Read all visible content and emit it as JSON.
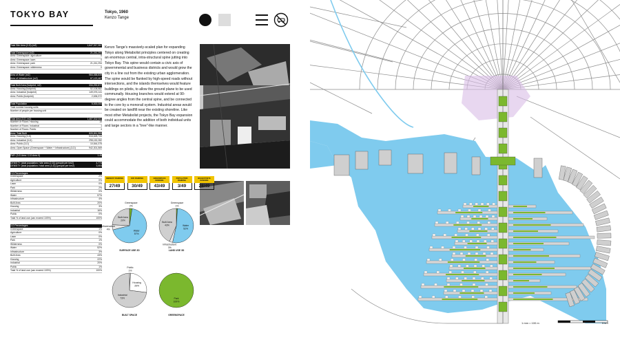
{
  "header": {
    "title": "TOKYO BAY",
    "project_line": "Tokyo, 1960",
    "architect": "Kenzo Tange"
  },
  "stats": [
    {
      "label": "Total Site Area (2-D) (m2)",
      "value": "1,647,317,357",
      "hl": true
    },
    {
      "gap": true
    },
    {
      "label": "Total Greenspace (m2)",
      "value": "21,241,294",
      "hl": true
    },
    {
      "label": "Area: Greenspace: agriculture",
      "value": "0"
    },
    {
      "label": "Area: Greenspace: lawn",
      "value": "0"
    },
    {
      "label": "Area: Greenspace: park",
      "value": "21,241,294"
    },
    {
      "label": "Area: Greenspace: wilderness",
      "value": "0"
    },
    {
      "gap": true
    },
    {
      "label": "Area of Water (m2)",
      "value": "964,458,839",
      "hl": true
    },
    {
      "label": "Area of Infrastructure (m2)",
      "value": "67,122,467",
      "hl": true
    },
    {
      "gap": true
    },
    {
      "label": "Total Built Area (footprint, m2)",
      "value": "334,292,877",
      "hl": true
    },
    {
      "label": "Area: Housing (footprint)",
      "value": "52,108,582"
    },
    {
      "label": "Area: Industrial (footprint)",
      "value": "149,076,141"
    },
    {
      "label": "Area: Public (footprint)",
      "value": "2,636,372"
    },
    {
      "gap": true
    },
    {
      "label": "Total Population",
      "value": "5,000,000",
      "hl": true
    },
    {
      "label": "Total number housing units",
      "value": ""
    },
    {
      "label": "Number of people per housing unit",
      "value": ""
    },
    {
      "gap": true
    },
    {
      "label": "Total Area (3-D, m2)",
      "value": "1,487,532,511",
      "hl": true
    },
    {
      "label": "Number of Floors: Housing",
      "value": "15"
    },
    {
      "label": "Number of Floors: Industrial",
      "value": "1"
    },
    {
      "label": "Number of Floors: Public",
      "value": "4"
    },
    {
      "label": "Area: Total Built",
      "value": "820,811,959",
      "hl": true
    },
    {
      "label": "Area: Housing (3-D)",
      "value": "516,628,733"
    },
    {
      "label": "Area: Industrial (3-D)",
      "value": "298,152,282"
    },
    {
      "label": "Area: Public (3-D)",
      "value": "10,544,375"
    },
    {
      "label": "Area: Open Space (Greenspace + Water + Infrastructure) (3-D)",
      "value": "942,301,569"
    },
    {
      "gap": true
    },
    {
      "label": "FAR: (3-D Area / 2-D Area 0)",
      "value": "1.49",
      "hl": true
    },
    {
      "gap": true
    },
    {
      "label": "DENSITY (total population / site area (2-D)) (people per km2)",
      "value": "4,774",
      "hl": true
    },
    {
      "label": "DENSITY (total population / total area (3-D)) (people per km2)",
      "value": "3,404",
      "hl": true
    },
    {
      "gap": true
    },
    {
      "label": "2-D Percentages",
      "value": "",
      "hl": true
    },
    {
      "label": "Greenspace",
      "value": "2%"
    },
    {
      "label": "Agriculture",
      "value": "0%"
    },
    {
      "label": "Lawn",
      "value": "0%"
    },
    {
      "label": "Park",
      "value": "2%"
    },
    {
      "label": "Wilderness",
      "value": "0%"
    },
    {
      "label": "Water",
      "value": "57%"
    },
    {
      "label": "Infrastructure",
      "value": "4%"
    },
    {
      "label": "Built Area",
      "value": "20%"
    },
    {
      "label": "Housing",
      "value": "3%"
    },
    {
      "label": "Industrial",
      "value": "16%"
    },
    {
      "label": "Public",
      "value": "0%"
    },
    {
      "label": "Total % of land use (can exceed 100%)",
      "value": "100%"
    },
    {
      "gap": true
    },
    {
      "label": "3-D Percentages",
      "value": "",
      "hl": true
    },
    {
      "label": "Greenspace",
      "value": "1%"
    },
    {
      "label": "Agriculture",
      "value": "0%"
    },
    {
      "label": "Lawn",
      "value": "0%"
    },
    {
      "label": "Park",
      "value": "1%"
    },
    {
      "label": "Wilderness",
      "value": "0%"
    },
    {
      "label": "Water",
      "value": "52%"
    },
    {
      "label": "Infrastructure",
      "value": "3%"
    },
    {
      "label": "Built Area",
      "value": "43%"
    },
    {
      "label": "Housing",
      "value": "22%"
    },
    {
      "label": "Industrial",
      "value": "20%"
    },
    {
      "label": "Public",
      "value": "1%"
    },
    {
      "label": "Total % of land use (can exceed 100%)",
      "value": "100%"
    }
  ],
  "description": "Kenzo Tange's massively-scaled plan for expanding Tokyo along Metabolist principles centered on creating an enormous central, intra-structural spine jutting into Tokyo Bay. This spine would contain a civic axis of governmental and business districts and would grow the city in a line out from the existing urban agglomeration. The spine would be flanked by high-speed roads without intersections, and the islands themselves would feature buildings on pilotis, to allow the ground plane to be used communally. Housing branches would extend at 90-degree angles from the central spine, and be connected to the core by a monorail system. Industrial areas would be created on landfill near the existing shoreline. Like most other Metabolist projects, the Tokyo Bay expansion could accommodate the addition of both individual units and large sectors in a \"tree\"-like manner.",
  "rankings": [
    {
      "label": "DENSEST RANKING",
      "value": "27/49"
    },
    {
      "label": "FAR RANKING",
      "value": "30/49"
    },
    {
      "label": "GREENSPACE RANKING",
      "value": "43/49"
    },
    {
      "label": "POPULATION RANKING",
      "value": "3/49"
    },
    {
      "label": "BIGGEST/SITE RANKING",
      "value": "28/49"
    }
  ],
  "colors": {
    "water": "#7fcbee",
    "green": "#7bb82e",
    "built": "#cfcfcf",
    "infra": "#e8e8e8",
    "highlight": "#f1c400",
    "land": "#ffffff",
    "road": "#8a8a8a",
    "lilac": "#d9bce6"
  },
  "chart_data": [
    {
      "type": "pie",
      "title": "SURFACE USE 2D",
      "slices": [
        {
          "label": "Greenspace",
          "value": 2,
          "pct": "2%",
          "color": "#7bb82e"
        },
        {
          "label": "Water",
          "value": 57,
          "pct": "57%",
          "color": "#7fcbee"
        },
        {
          "label": "Infrastructure",
          "value": 4,
          "pct": "4%",
          "color": "#e8e8e8"
        },
        {
          "label": "Built Area",
          "value": 20,
          "pct": "20%",
          "color": "#cfcfcf"
        }
      ]
    },
    {
      "type": "pie",
      "title": "LAND USE 3D",
      "slices": [
        {
          "label": "Greenspace",
          "value": 1,
          "pct": "1%",
          "color": "#7bb82e"
        },
        {
          "label": "Water",
          "value": 52,
          "pct": "52%",
          "color": "#7fcbee"
        },
        {
          "label": "Infrastructure",
          "value": 3,
          "pct": "3%",
          "color": "#e8e8e8"
        },
        {
          "label": "Built Area",
          "value": 43,
          "pct": "43%",
          "color": "#cfcfcf"
        }
      ]
    },
    {
      "type": "pie",
      "title": "BUILT SPACE",
      "slices": [
        {
          "label": "Public",
          "value": 1,
          "pct": "1%",
          "color": "#ffffff"
        },
        {
          "label": "Housing",
          "value": 26,
          "pct": "26%",
          "color": "#ffffff"
        },
        {
          "label": "Industrial",
          "value": 73,
          "pct": "73%",
          "color": "#cfcfcf"
        }
      ]
    },
    {
      "type": "pie",
      "title": "GREENSPACE",
      "slices": [
        {
          "label": "Park",
          "value": 100,
          "pct": "100%",
          "color": "#7bb82e"
        }
      ]
    }
  ],
  "map": {
    "scale_label": "1 mm = 100 m",
    "scale_end": "5 km"
  }
}
